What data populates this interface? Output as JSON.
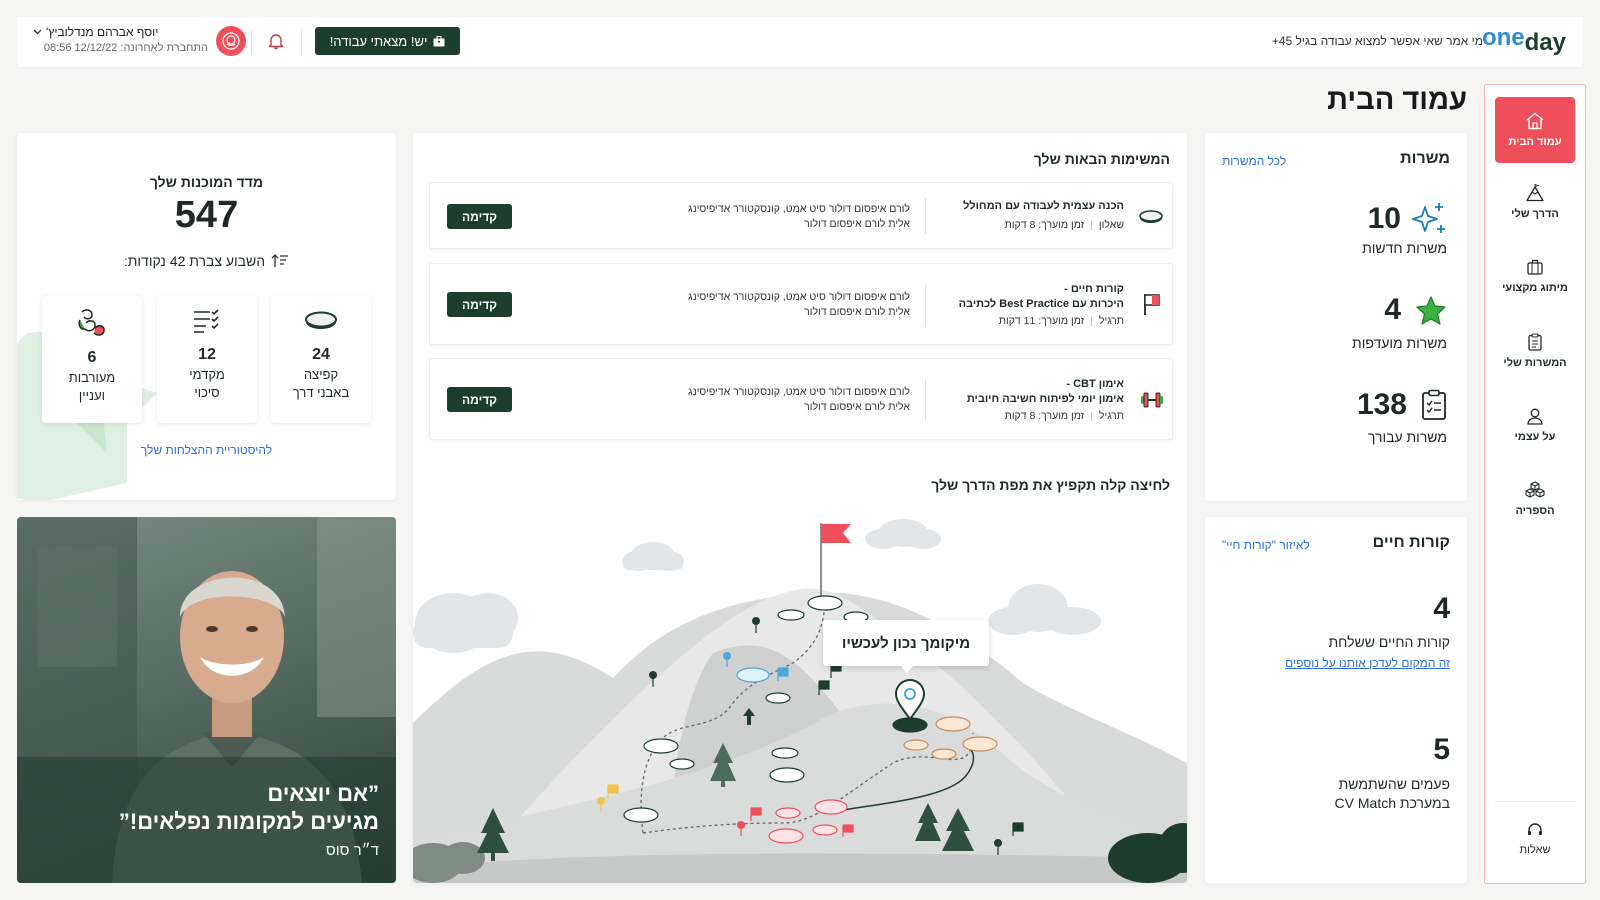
{
  "brand": {
    "logo_day": "day",
    "logo_one": "one",
    "tagline": "מי אמר שאי אפשר למצוא עבודה בגיל 45+"
  },
  "header": {
    "found_job_button": "יש! מצאתי עבודה!",
    "user_name": "יוסף אברהם מנדלוביץ'",
    "last_login": "התחברת לאחרונה: 12/12/22 08:56"
  },
  "page_title": "עמוד הבית",
  "sidebar": {
    "items": [
      {
        "label": "עמוד הבית",
        "icon": "home-icon"
      },
      {
        "label": "הדרך שלי",
        "icon": "mountain-icon"
      },
      {
        "label": "מיתוג מקצועי",
        "icon": "briefcase-icon"
      },
      {
        "label": "המשרות שלי",
        "icon": "clipboard-icon"
      },
      {
        "label": "על עצמי",
        "icon": "user-icon"
      },
      {
        "label": "הספריה",
        "icon": "blocks-icon"
      }
    ],
    "questions_label": "שאלות"
  },
  "jobs": {
    "title": "משרות",
    "all_link": "לכל המשרות",
    "stats": [
      {
        "value": "10",
        "label": "משרות חדשות",
        "icon": "sparkle-icon"
      },
      {
        "value": "4",
        "label": "משרות מועדפות",
        "icon": "star-icon"
      },
      {
        "value": "138",
        "label": "משרות עבורך",
        "icon": "clipboard-check-icon"
      }
    ]
  },
  "resumes": {
    "title": "קורות חיים",
    "area_link": "לאיזור \"קורות חיי\"",
    "sent_value": "4",
    "sent_label": "קורות החיים ששלחת",
    "update_link": "זה המקום לעדכן אותנו על נוספים",
    "cv_value": "5",
    "cv_label_1": "פעמים שהשתמשת",
    "cv_label_2": "במערכת CV Match"
  },
  "tasks": {
    "title": "המשימות הבאות שלך",
    "items": [
      {
        "title_1": "הכנה עצמית לעבודה עם המחולל",
        "title_2": "",
        "type": "שאלון",
        "time": "זמן מוערך: 8 דקות",
        "desc_1": "לורם איפסום דולור סיט אמט, קונסקטורר אדיפיסינג",
        "desc_2": "אלית לורם איפסום דולור",
        "button": "קדימה",
        "icon": "stone-icon"
      },
      {
        "title_1": "קורות חיים -",
        "title_2": "היכרות עם Best Practice לכתיבה",
        "type": "תרגיל",
        "time": "זמן מוערך: 11 דקות",
        "desc_1": "לורם איפסום דולור סיט אמט, קונסקטורר אדיפיסינג",
        "desc_2": "אלית לורם איפסום דולור",
        "button": "קדימה",
        "icon": "flag-icon"
      },
      {
        "title_1": "אימון CBT -",
        "title_2": "אימון יומי לפיתוח חשיבה חיובית",
        "type": "תרגיל",
        "time": "זמן מוערך: 8 דקות",
        "desc_1": "לורם איפסום דולור סיט אמט, קונסקטורר אדיפיסינג",
        "desc_2": "אלית לורם איפסום דולור",
        "button": "קדימה",
        "icon": "dumbbell-icon"
      }
    ]
  },
  "map": {
    "title": "לחיצה קלה תקפיץ את מפת הדרך שלך",
    "tooltip": "מיקומך נכון לעכשיו"
  },
  "readiness": {
    "title": "מדד המוכנות שלך",
    "score": "547",
    "weekly": "השבוע צברת 42 נקודות:",
    "items": [
      {
        "value": "24",
        "label_1": "קפיצה",
        "label_2": "באבני דרך",
        "icon": "stone-icon"
      },
      {
        "value": "12",
        "label_1": "מקדמי",
        "label_2": "סיכוי",
        "icon": "checklist-icon"
      },
      {
        "value": "6",
        "label_1": "מעורבות",
        "label_2": "ועניין",
        "icon": "hands-icon"
      }
    ],
    "history_link": "להיסטוריית ההצלחות שלך"
  },
  "quote": {
    "line_1": "”אם יוצאים",
    "line_2": "מגיעים למקומות נפלאים!”",
    "author": "ד״ר סוס"
  },
  "colors": {
    "primary_dark": "#1d3d2d",
    "accent_red": "#ee4f5b",
    "link": "#2c6fd6",
    "green_star": "#3cb043"
  }
}
